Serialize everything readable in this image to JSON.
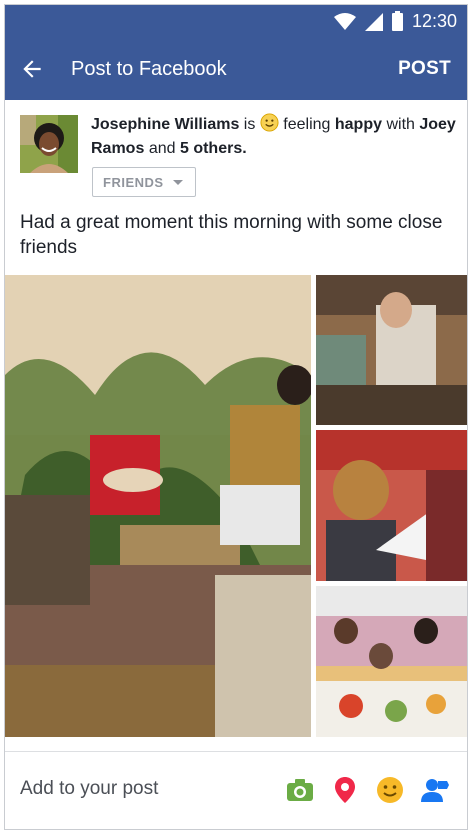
{
  "status_bar": {
    "time": "12:30"
  },
  "app_bar": {
    "title": "Post to Facebook",
    "post_label": "POST"
  },
  "author": {
    "name": "Josephine Williams",
    "is_word": "is",
    "feeling_word": "feeling",
    "feeling": "happy",
    "with_word": "with",
    "tagged_friend": "Joey Ramos",
    "and_word": "and",
    "others": "5 others."
  },
  "audience": {
    "label": "FRIENDS"
  },
  "post_text": "Had a great moment this morning with some close friends",
  "photos": [
    {
      "name": "photo-main-room"
    },
    {
      "name": "photo-bookshop"
    },
    {
      "name": "photo-child-paper-plane"
    },
    {
      "name": "photo-dinner-table"
    }
  ],
  "bottom_bar": {
    "add_label": "Add to your post",
    "icons": [
      "camera-icon",
      "location-pin-icon",
      "feeling-emoji-icon",
      "tag-friends-icon"
    ],
    "colors": {
      "camera": "#6bac45",
      "location": "#f02849",
      "feeling": "#f7b928",
      "tag": "#1877f2"
    }
  },
  "colors": {
    "brand": "#3b5998",
    "text": "#1d2129",
    "muted": "#90949c"
  }
}
